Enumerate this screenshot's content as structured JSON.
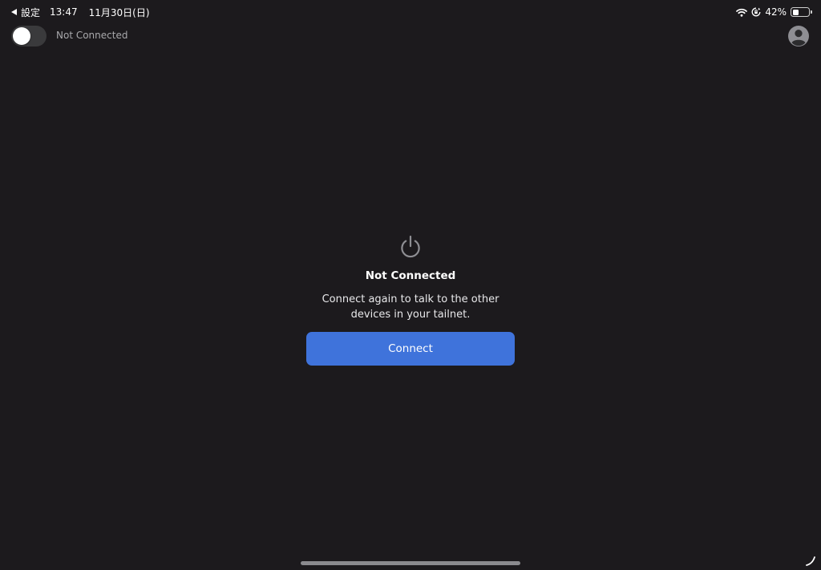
{
  "status_bar": {
    "back_app": "設定",
    "time": "13:47",
    "date": "11月30日(日)",
    "battery_percent": "42%",
    "battery_level": 0.42,
    "icons": [
      "back-arrow-icon",
      "wifi-icon",
      "orientation-lock-icon",
      "battery-icon"
    ]
  },
  "header": {
    "vpn_toggle_on": false,
    "status": "Not Connected",
    "account_icon": "person-icon"
  },
  "main": {
    "icon": "power-icon",
    "title": "Not Connected",
    "message": "Connect again to talk to the other devices in your tailnet.",
    "connect_label": "Connect"
  },
  "colors": {
    "background": "#1c1a1d",
    "accent": "#3f73db",
    "secondary_text": "#a8a8ab",
    "toggle_off": "#3a3a3c"
  }
}
